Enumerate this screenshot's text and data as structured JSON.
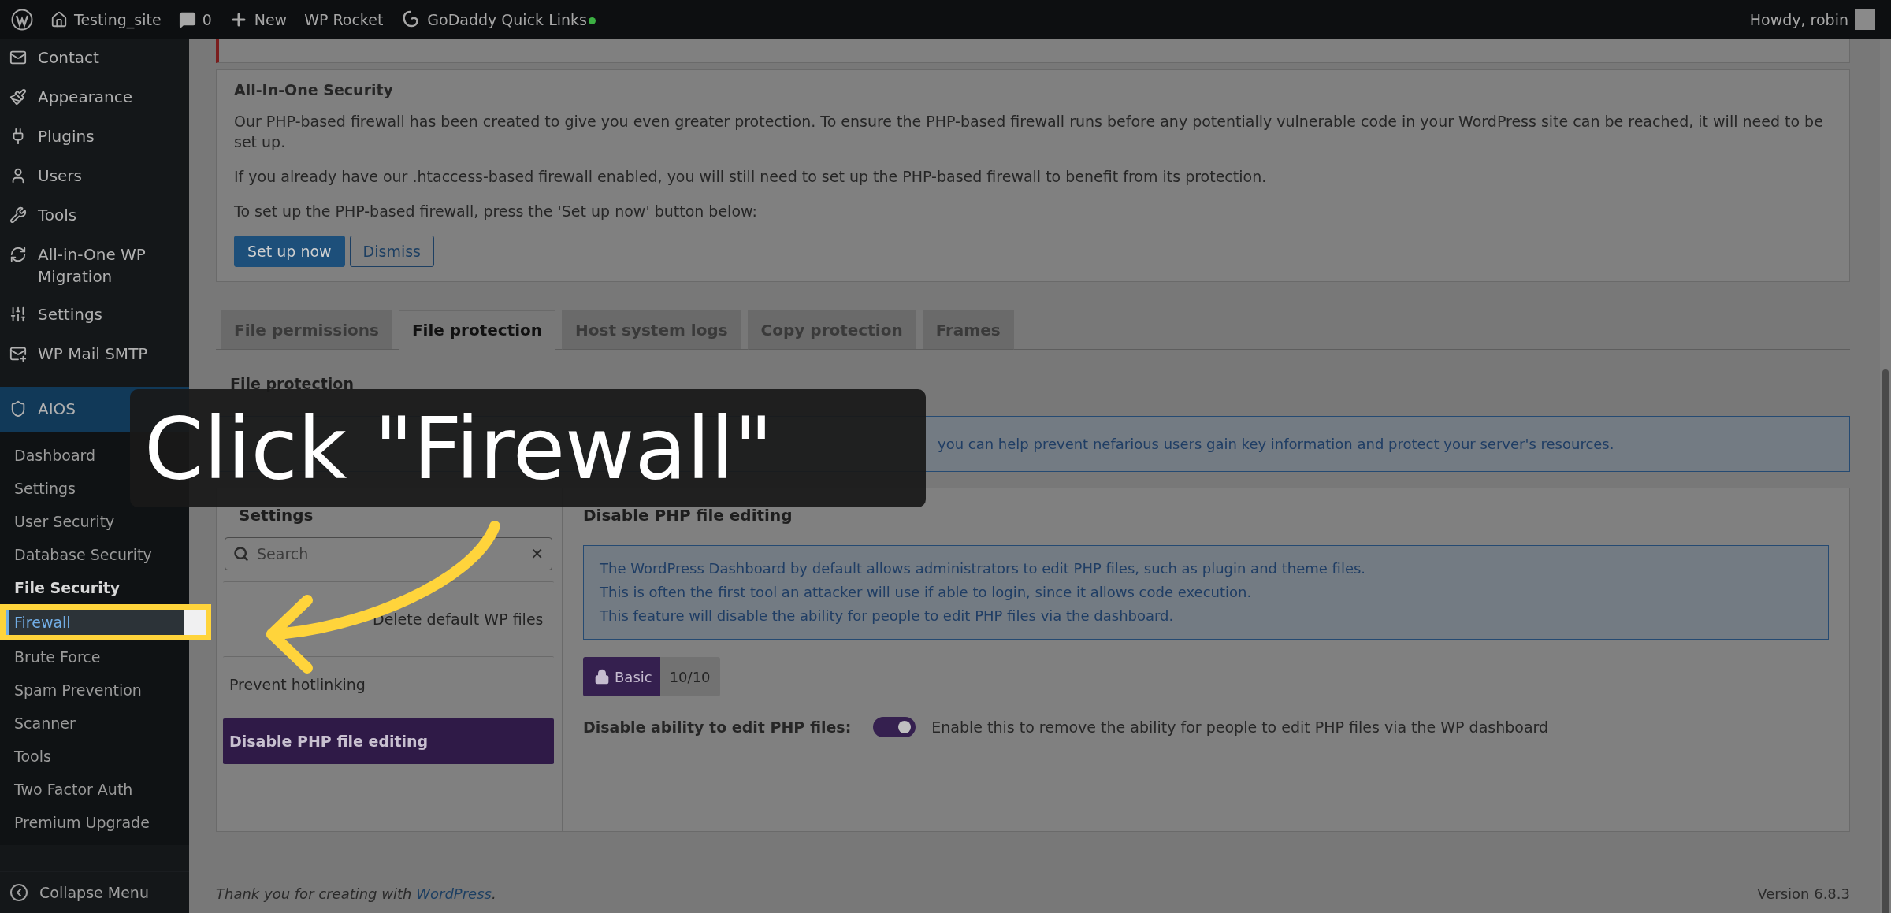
{
  "top_bar": {
    "site": "Testing_site",
    "comments": "0",
    "new": "New",
    "rocket": "WP Rocket",
    "godaddy": "GoDaddy Quick Links",
    "greeting": "Howdy, robin"
  },
  "sidebar": {
    "items": [
      {
        "label": "Contact",
        "selected": false
      },
      {
        "label": "Appearance",
        "selected": false
      },
      {
        "label": "Plugins",
        "selected": false
      },
      {
        "label": "Users",
        "selected": false
      },
      {
        "label": "Tools",
        "selected": false
      },
      {
        "label": "All-in-One WP Migration",
        "selected": false
      },
      {
        "label": "Settings",
        "selected": false
      },
      {
        "label": "WP Mail SMTP",
        "selected": false
      },
      {
        "label": "AIOS",
        "selected": true
      }
    ],
    "submenu": [
      {
        "label": "Dashboard",
        "selected": false,
        "highlighted": false
      },
      {
        "label": "Settings",
        "selected": false,
        "highlighted": false
      },
      {
        "label": "User Security",
        "selected": false,
        "highlighted": false
      },
      {
        "label": "Database Security",
        "selected": false,
        "highlighted": false
      },
      {
        "label": "File Security",
        "selected": true,
        "highlighted": false
      },
      {
        "label": "Firewall",
        "selected": false,
        "highlighted": true
      },
      {
        "label": "Brute Force",
        "selected": false,
        "highlighted": false
      },
      {
        "label": "Spam Prevention",
        "selected": false,
        "highlighted": false
      },
      {
        "label": "Scanner",
        "selected": false,
        "highlighted": false
      },
      {
        "label": "Tools",
        "selected": false,
        "highlighted": false
      },
      {
        "label": "Two Factor Auth",
        "selected": false,
        "highlighted": false
      },
      {
        "label": "Premium Upgrade",
        "selected": false,
        "highlighted": false
      }
    ],
    "collapse": "Collapse Menu"
  },
  "notice": {
    "title": "All-In-One Security",
    "paragraphs": [
      "Our PHP-based firewall has been created to give you even greater protection. To ensure the PHP-based firewall runs before any potentially vulnerable code in your WordPress site can be reached, it will need to be set up.",
      "If you already have our .htaccess-based firewall enabled, you will still need to set up the PHP-based firewall to benefit from its protection.",
      "To set up the PHP-based firewall, press the 'Set up now' button below:"
    ],
    "buttons": [
      "Set up now",
      "Dismiss"
    ]
  },
  "tabs": [
    {
      "label": "File permissions",
      "selected": false
    },
    {
      "label": "File protection",
      "selected": true
    },
    {
      "label": "Host system logs",
      "selected": false
    },
    {
      "label": "Copy protection",
      "selected": false
    },
    {
      "label": "Frames",
      "selected": false
    }
  ],
  "section": {
    "title": "File protection",
    "info": "you can help prevent nefarious users gain key information and protect your server's resources."
  },
  "settings": {
    "title": "Settings",
    "search": {
      "placeholder": "Search",
      "clear": "✕"
    },
    "items": [
      {
        "label": "Delete default WP files",
        "selected": false
      },
      {
        "label": "Prevent hotlinking",
        "selected": false
      },
      {
        "label": "Disable PHP file editing",
        "selected": true
      }
    ]
  },
  "detail": {
    "title": "Disable PHP file editing",
    "info": [
      "The WordPress Dashboard by default allows administrators to edit PHP files, such as plugin and theme files.",
      "This is often the first tool an attacker will use if able to login, since it allows code execution.",
      "This feature will disable the ability for people to edit PHP files via the dashboard."
    ],
    "badge": {
      "label": "Basic",
      "score": "10/10"
    },
    "option": {
      "label": "Disable ability to edit PHP files:",
      "on": true,
      "description": "Enable this to remove the ability for people to edit PHP files via the WP dashboard"
    }
  },
  "footer": {
    "thanks": "Thank you for creating with",
    "link": "WordPress",
    "period": ".",
    "version": "Version 6.8.3"
  },
  "tutorial": {
    "caption": "Click \"Firewall\""
  }
}
